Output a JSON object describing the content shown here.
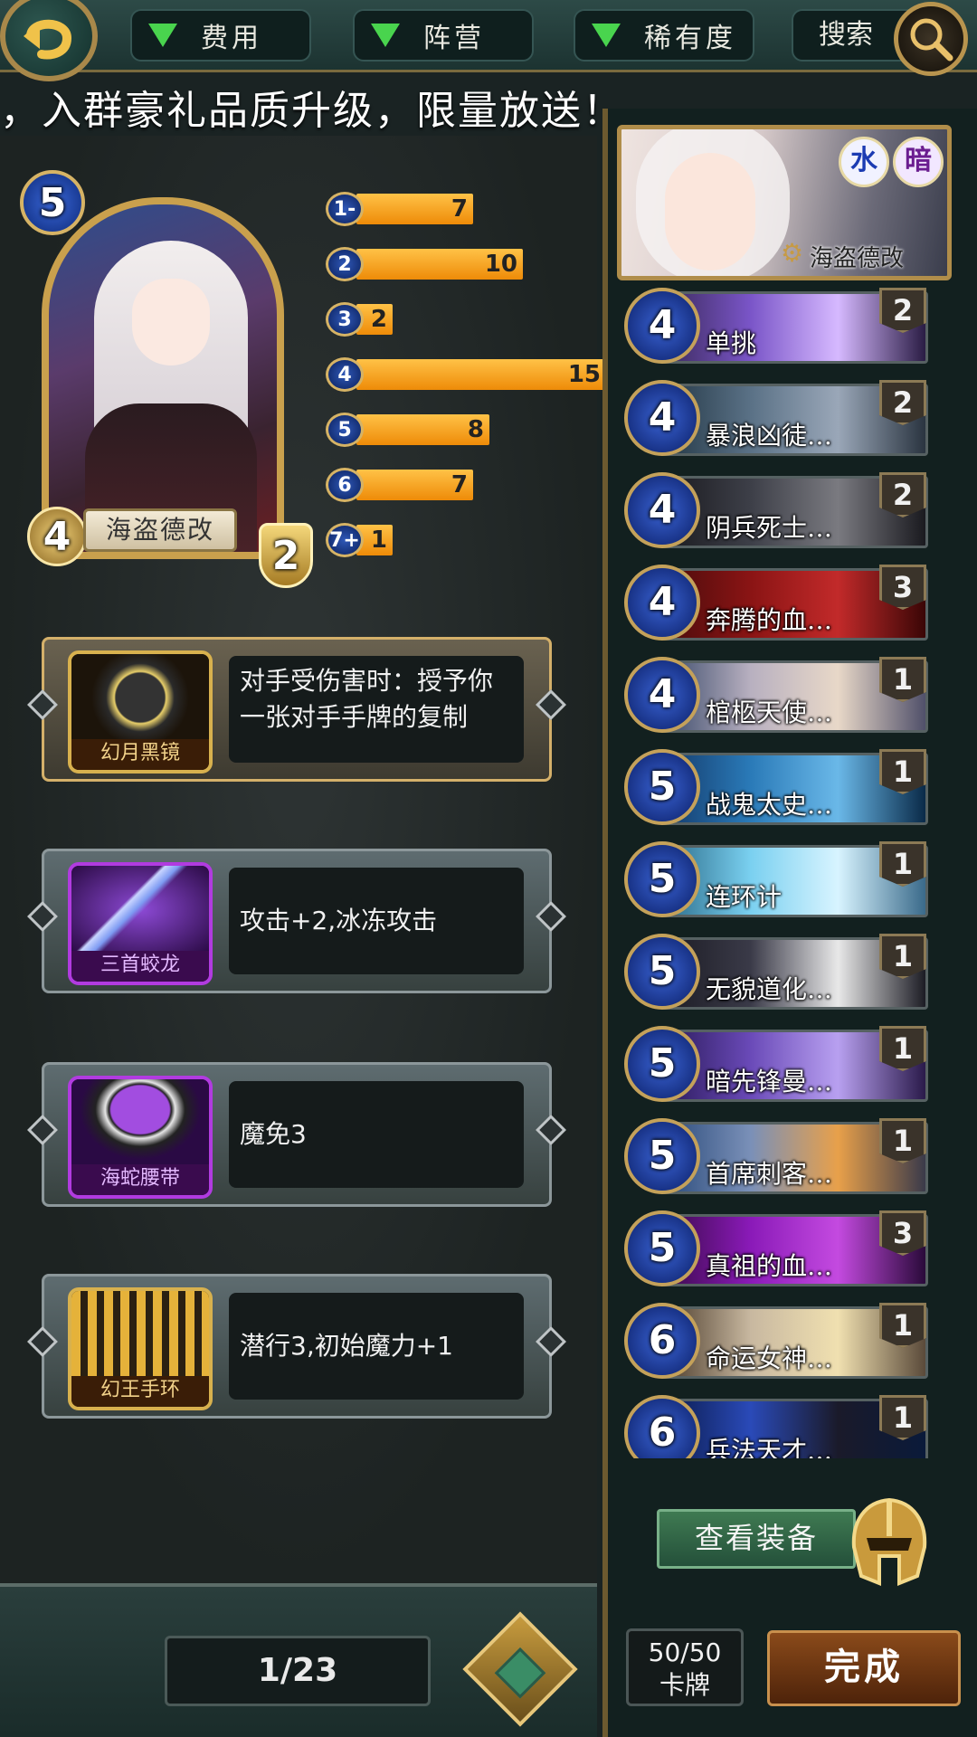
{
  "header": {
    "filters": [
      "费用",
      "阵营",
      "稀有度"
    ],
    "search_label": "搜索",
    "marquee": "，入群豪礼品质升级，限量放送！"
  },
  "hero": {
    "name": "海盗德改",
    "cost": "5",
    "attack": "4",
    "health": "2"
  },
  "cost_curve": [
    {
      "label": "1-",
      "count": 7
    },
    {
      "label": "2",
      "count": 10
    },
    {
      "label": "3",
      "count": 2
    },
    {
      "label": "4",
      "count": 15
    },
    {
      "label": "5",
      "count": 8
    },
    {
      "label": "6",
      "count": 7
    },
    {
      "label": "7+",
      "count": 1
    }
  ],
  "equipment": [
    {
      "name": "幻月黑镜",
      "effect": "对手受伤害时：授予你一张对手手牌的复制",
      "rarity_color": "#d8b14e"
    },
    {
      "name": "三首蛟龙",
      "effect": "攻击+2,冰冻攻击",
      "rarity_color": "#b13be0"
    },
    {
      "name": "海蛇腰带",
      "effect": "魔免3",
      "rarity_color": "#b13be0"
    },
    {
      "name": "幻王手环",
      "effect": "潜行3,初始魔力+1",
      "rarity_color": "#d8b14e"
    }
  ],
  "pager": {
    "text": "1/23"
  },
  "deck": {
    "hero_name": "海盗德改",
    "elements": [
      "水",
      "暗"
    ],
    "cards": [
      {
        "cost": "4",
        "name": "单挑",
        "count": "2"
      },
      {
        "cost": "4",
        "name": "暴浪凶徒…",
        "count": "2"
      },
      {
        "cost": "4",
        "name": "阴兵死士…",
        "count": "2"
      },
      {
        "cost": "4",
        "name": "奔腾的血…",
        "count": "3"
      },
      {
        "cost": "4",
        "name": "棺柩天使…",
        "count": "1"
      },
      {
        "cost": "5",
        "name": "战鬼太史…",
        "count": "1"
      },
      {
        "cost": "5",
        "name": "连环计",
        "count": "1"
      },
      {
        "cost": "5",
        "name": "无貌道化…",
        "count": "1"
      },
      {
        "cost": "5",
        "name": "暗先锋曼…",
        "count": "1"
      },
      {
        "cost": "5",
        "name": "首席刺客…",
        "count": "1"
      },
      {
        "cost": "5",
        "name": "真祖的血…",
        "count": "3"
      },
      {
        "cost": "6",
        "name": "命运女神…",
        "count": "1"
      },
      {
        "cost": "6",
        "name": "兵法天才…",
        "count": "1"
      }
    ],
    "view_equipment_label": "查看装备",
    "count_value": "50/50",
    "count_label": "卡牌",
    "done_label": "完成"
  }
}
